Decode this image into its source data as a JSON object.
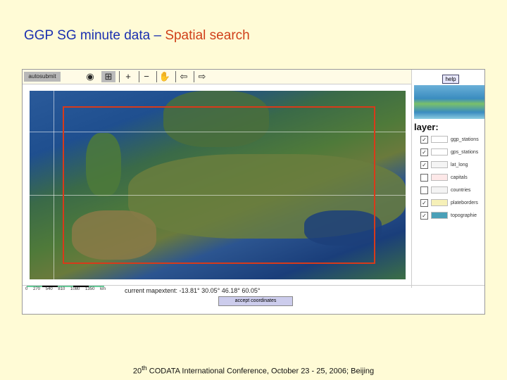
{
  "title": {
    "main": "GGP SG minute data – ",
    "highlight": "Spatial search"
  },
  "toolbar": {
    "autosubmit": "autosubmit"
  },
  "help": "help",
  "layers": {
    "heading": "layer:",
    "items": [
      {
        "label": "ggp_stations",
        "checked": true,
        "color": "#ffffff"
      },
      {
        "label": "gps_stations",
        "checked": true,
        "color": "#ffffff"
      },
      {
        "label": "lat_long",
        "checked": true,
        "color": "#f4f4f4"
      },
      {
        "label": "capitals",
        "checked": false,
        "color": "#fde8e8"
      },
      {
        "label": "countries",
        "checked": false,
        "color": "#f4f4f4"
      },
      {
        "label": "plateborders",
        "checked": true,
        "color": "#f6f0b8"
      },
      {
        "label": "topographie",
        "checked": true,
        "color": "#4aa0b8"
      }
    ]
  },
  "scale": "0 270 540 810 1080 1350 km",
  "extent": "current mapextent: -13.81° 30.05° 46.18° 60.05°",
  "accept": "accept coordinates",
  "footer": {
    "sup": "th",
    "pre": "20",
    "text": " CODATA International Conference, October 23 - 25, 2006; Beijing"
  }
}
